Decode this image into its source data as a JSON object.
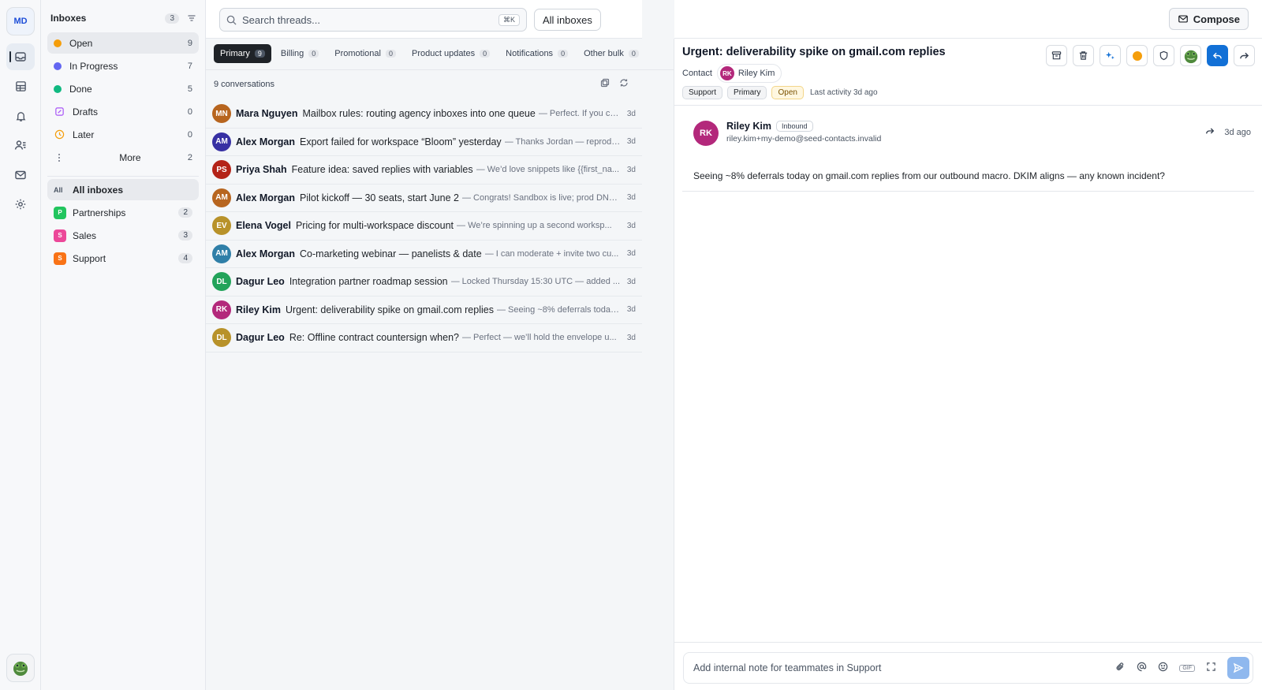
{
  "workspace": {
    "initials": "MD"
  },
  "rail": {
    "items": [
      "inbox-icon",
      "grid-icon",
      "bell-icon",
      "contacts-icon",
      "mail-icon",
      "settings-icon"
    ]
  },
  "sidebar": {
    "title": "Inboxes",
    "count": "3",
    "statuses": [
      {
        "label": "Open",
        "count": "9",
        "color": "#f59e0b"
      },
      {
        "label": "In Progress",
        "count": "7",
        "color": "#6366f1"
      },
      {
        "label": "Done",
        "count": "5",
        "color": "#10b981"
      },
      {
        "label": "Drafts",
        "count": "0"
      },
      {
        "label": "Later",
        "count": "0"
      },
      {
        "label": "More",
        "count": "2"
      }
    ],
    "all_chip": "All",
    "all_label": "All inboxes",
    "inboxes": [
      {
        "chip": "P",
        "label": "Partnerships",
        "count": "2",
        "color": "#22c55e"
      },
      {
        "chip": "S",
        "label": "Sales",
        "count": "3",
        "color": "#ec4899"
      },
      {
        "chip": "S",
        "label": "Support",
        "count": "4",
        "color": "#f97316"
      }
    ]
  },
  "list": {
    "search_placeholder": "Search threads...",
    "shortcut": "⌘K",
    "inbox_filter": "All inboxes",
    "tabs": [
      {
        "label": "Primary",
        "count": "9"
      },
      {
        "label": "Billing",
        "count": "0"
      },
      {
        "label": "Promotional",
        "count": "0"
      },
      {
        "label": "Product updates",
        "count": "0"
      },
      {
        "label": "Notifications",
        "count": "0"
      },
      {
        "label": "Other bulk",
        "count": "0"
      }
    ],
    "conversations_count": "9 conversations",
    "rows": [
      {
        "initials": "MN",
        "color": "#b7651f",
        "name": "Mara Nguyen",
        "subject": "Mailbox rules: routing agency inboxes into one queue",
        "snippet": "— Perfect. If you ca...",
        "time": "3d"
      },
      {
        "initials": "AM",
        "color": "#3730a3",
        "name": "Alex Morgan",
        "subject": "Export failed for workspace “Bloom” yesterday",
        "snippet": "— Thanks Jordan — reprodu...",
        "time": "3d"
      },
      {
        "initials": "PS",
        "color": "#b42318",
        "name": "Priya Shah",
        "subject": "Feature idea: saved replies with variables",
        "snippet": "— We’d love snippets like {{first_na...",
        "time": "3d"
      },
      {
        "initials": "AM",
        "color": "#b7651f",
        "name": "Alex Morgan",
        "subject": "Pilot kickoff — 30 seats, start June 2",
        "snippet": "— Congrats! Sandbox is live; prod DNS ...",
        "time": "3d"
      },
      {
        "initials": "EV",
        "color": "#b8922a",
        "name": "Elena Vogel",
        "subject": "Pricing for multi-workspace discount",
        "snippet": "— We’re spinning up a second worksp...",
        "time": "3d"
      },
      {
        "initials": "AM",
        "color": "#2f7fa8",
        "name": "Alex Morgan",
        "subject": "Co-marketing webinar — panelists & date",
        "snippet": "— I can moderate + invite two cu...",
        "time": "3d"
      },
      {
        "initials": "DL",
        "color": "#22a35a",
        "name": "Dagur Leo",
        "subject": "Integration partner roadmap session",
        "snippet": "— Locked Thursday 15:30 UTC — added ...",
        "time": "3d"
      },
      {
        "initials": "RK",
        "color": "#b3287b",
        "name": "Riley Kim",
        "subject": "Urgent: deliverability spike on gmail.com replies",
        "snippet": "— Seeing ~8% deferrals today ...",
        "time": "3d"
      },
      {
        "initials": "DL",
        "color": "#b8922a",
        "name": "Dagur Leo",
        "subject": "Re: Offline contract countersign when?",
        "snippet": "— Perfect — we’ll hold the envelope u...",
        "time": "3d"
      }
    ]
  },
  "detail": {
    "compose_label": "Compose",
    "subject": "Urgent: deliverability spike on gmail.com replies",
    "contact_label": "Contact",
    "contact": {
      "initials": "RK",
      "name": "Riley Kim"
    },
    "tags": [
      "Support",
      "Primary"
    ],
    "status_tag": "Open",
    "last_activity": "Last activity 3d ago",
    "message": {
      "initials": "RK",
      "from": "Riley Kim",
      "direction": "Inbound",
      "email": "riley.kim+my-demo@seed-contacts.invalid",
      "time": "3d ago",
      "body": "Seeing ~8% deferrals today on gmail.com replies from our outbound macro. DKIM aligns — any known incident?"
    },
    "note_placeholder": "Add internal note for teammates in Support",
    "gif_label": "GIF"
  },
  "colors": {
    "accent": "#1270d6",
    "contact": "#b3287b"
  }
}
